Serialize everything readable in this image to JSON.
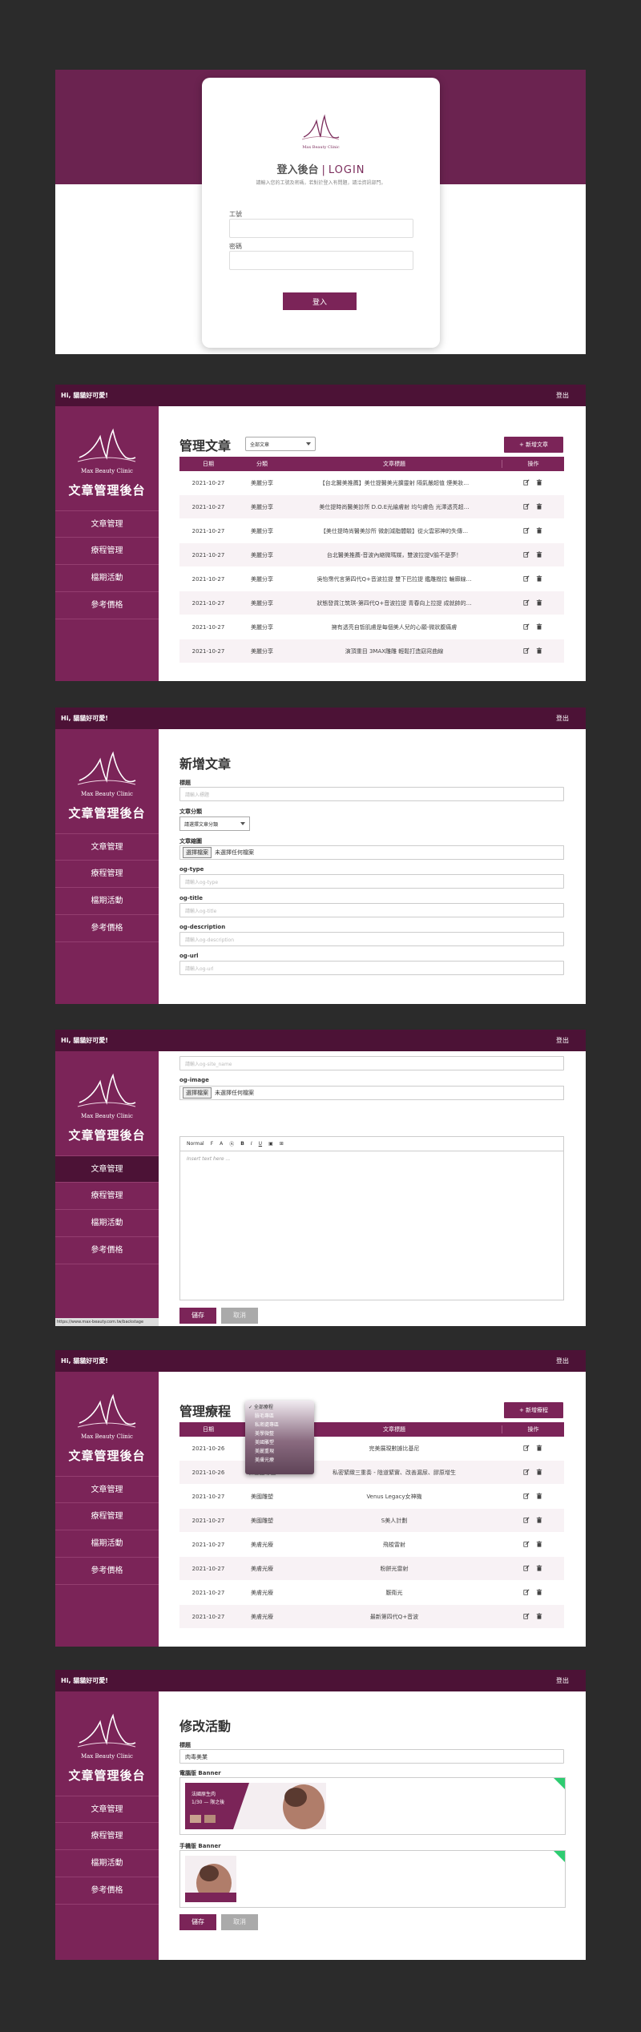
{
  "brand": {
    "logo_text": "Max Beauty Clinic",
    "admin_title": "文章管理後台"
  },
  "colors": {
    "primary": "#7b2458",
    "dark": "#4c1236",
    "band": "#6b2350"
  },
  "login": {
    "title": "登入後台",
    "title_en": "LOGIN",
    "hint": "請輸入您的工號及密碼，若對於登入有問題，請洽資訊部門。",
    "username_label": "工號",
    "password_label": "密碼",
    "submit_label": "登入"
  },
  "topbar": {
    "greeting": "Hi, 貓貓好可愛!",
    "logout": "登出"
  },
  "nav": [
    "文章管理",
    "療程管理",
    "檔期活動",
    "參考價格"
  ],
  "articles": {
    "title": "管理文章",
    "filter": "全部文章",
    "add_button": "+ 新增文章",
    "columns": [
      "日期",
      "分類",
      "文章標題",
      "操作"
    ],
    "rows": [
      {
        "date": "2021-10-27",
        "cat": "美麗分享",
        "title": "【台北醫美推薦】美仕提醫美光擴靈射 隔氣嚴超值 煙美妝…"
      },
      {
        "date": "2021-10-27",
        "cat": "美麗分享",
        "title": "美仕提時尚醫美診所 D.O.E光繪膚射 均勻膚色 光澤透亮超…"
      },
      {
        "date": "2021-10-27",
        "cat": "美麗分享",
        "title": "【美仕提時尚醫美診所 微創減脂體驗】從火雲邪神的失傳…"
      },
      {
        "date": "2021-10-27",
        "cat": "美麗分享",
        "title": "台北醫美推薦-音波內縮微瑪媒，雙波拉提V臉不是夢！"
      },
      {
        "date": "2021-10-27",
        "cat": "美麗分享",
        "title": "吳怡霈代言第四代Q+音波拉提 雙下巴拉提 鑑雕撥拉 輪廓線…"
      },
      {
        "date": "2021-10-27",
        "cat": "美麗分享",
        "title": "狀態發貨江筑琪-第四代Q+音波拉提 青春向上拉提 成就帥的…"
      },
      {
        "date": "2021-10-27",
        "cat": "美麗分享",
        "title": "擁有透亮自皙肌膚是每個美人兒的心願-微狀腹痛膚"
      },
      {
        "date": "2021-10-27",
        "cat": "美麗分享",
        "title": "演頂重目 3MAX雕雕 輕鬆打造窈窕曲線"
      }
    ]
  },
  "new_article": {
    "title": "新增文章",
    "f_title_label": "標題",
    "f_title_ph": "請輸入標題",
    "f_cat_label": "文章分類",
    "f_cat_value": "請選擇文章分類",
    "f_cover_label": "文章縮圖",
    "file_button": "選擇檔案",
    "file_none": "未選擇任何檔案",
    "og_type_label": "og-type",
    "og_type_ph": "請輸入og-type",
    "og_title_label": "og-title",
    "og_title_ph": "請輸入og-title",
    "og_desc_label": "og-description",
    "og_desc_ph": "請輸入og-description",
    "og_url_label": "og-url",
    "og_url_ph": "請輸入og-url"
  },
  "editor_screen": {
    "site_name_ph": "請輸入og-site_name",
    "og_image_label": "og-image",
    "toolbar_normal": "Normal",
    "toolbar_f": "F",
    "toolbar_a": "A",
    "toolbar_b": "B",
    "toolbar_i": "I",
    "toolbar_u": "U",
    "editor_ph": "Insert text here ...",
    "save": "儲存",
    "cancel": "取消",
    "status_url": "https://www.max-beauty.com.tw/backstage"
  },
  "treatments": {
    "title": "管理療程",
    "add_button": "+ 新增療程",
    "columns": [
      "日期",
      "分類",
      "文章標題",
      "操作"
    ],
    "dropdown": [
      "✓ 全部療程",
      "臉毛專區",
      "私密處專區",
      "美學微整",
      "美國雕塑",
      "美麗重現",
      "美膚光療"
    ],
    "rows": [
      {
        "date": "2021-10-26",
        "cat": "",
        "title": "完美展現數據比基尼"
      },
      {
        "date": "2021-10-26",
        "cat": "私密處專區",
        "title": "私密緊緻三重奏 - 陰道緊實、改善漏尿、膠原增生"
      },
      {
        "date": "2021-10-27",
        "cat": "美國雕塑",
        "title": "Venus Legacy女神機"
      },
      {
        "date": "2021-10-27",
        "cat": "美國雕塑",
        "title": "S美人計劃"
      },
      {
        "date": "2021-10-27",
        "cat": "美膚光療",
        "title": "飛梭雷射"
      },
      {
        "date": "2021-10-27",
        "cat": "美膚光療",
        "title": "粉餅光雷射"
      },
      {
        "date": "2021-10-27",
        "cat": "美膚光療",
        "title": "厭衛光"
      },
      {
        "date": "2021-10-27",
        "cat": "美膚光療",
        "title": "最新第四代Q+音波"
      }
    ]
  },
  "edit_event": {
    "title": "修改活動",
    "f_title_label": "標題",
    "f_title_value": "肉毒美業",
    "desktop_label": "電腦版 Banner",
    "mobile_label": "手機版 Banner",
    "banner_line1": "法國原生肉",
    "banner_line2": "1/30 — 限之後",
    "save": "儲存",
    "cancel": "取消"
  }
}
